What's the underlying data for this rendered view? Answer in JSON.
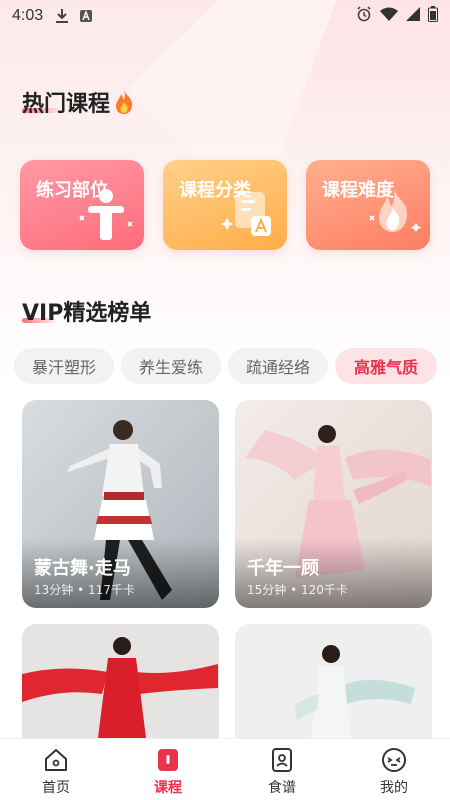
{
  "status_bar": {
    "time": "4:03"
  },
  "hot_section": {
    "title": "热门课程"
  },
  "categories": [
    {
      "label": "练习部位"
    },
    {
      "label": "课程分类"
    },
    {
      "label": "课程难度"
    }
  ],
  "vip_section": {
    "title": "VIP精选榜单"
  },
  "filter_tabs": [
    {
      "label": "暴汗塑形"
    },
    {
      "label": "养生爱练"
    },
    {
      "label": "疏通经络"
    },
    {
      "label": "高雅气质",
      "selected": true
    }
  ],
  "courses": [
    {
      "title": "蒙古舞·走马",
      "meta": "13分钟 • 117千卡"
    },
    {
      "title": "千年一顾",
      "meta": "15分钟 • 120千卡"
    },
    {
      "title": "",
      "meta": ""
    },
    {
      "title": "",
      "meta": ""
    }
  ],
  "bottom_nav": [
    {
      "label": "首页",
      "icon": "home-icon"
    },
    {
      "label": "课程",
      "icon": "course-icon",
      "active": true
    },
    {
      "label": "食谱",
      "icon": "recipe-icon"
    },
    {
      "label": "我的",
      "icon": "profile-icon"
    }
  ],
  "colors": {
    "accent": "#e8334a",
    "tab_active_bg": "#fde3e6"
  }
}
